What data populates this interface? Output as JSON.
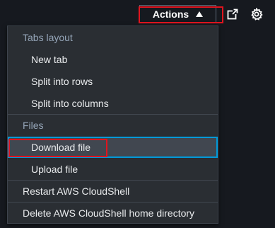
{
  "toolbar": {
    "actions_label": "Actions",
    "open_new_icon": "external-link-icon",
    "settings_icon": "gear-icon"
  },
  "menu": {
    "tabs_layout_label": "Tabs layout",
    "new_tab": "New tab",
    "split_rows": "Split into rows",
    "split_columns": "Split into columns",
    "files_label": "Files",
    "download_file": "Download file",
    "upload_file": "Upload file",
    "restart": "Restart AWS CloudShell",
    "delete_home": "Delete AWS CloudShell home directory"
  },
  "colors": {
    "highlight_red": "#e0141e",
    "focus_blue": "#0099d8"
  }
}
